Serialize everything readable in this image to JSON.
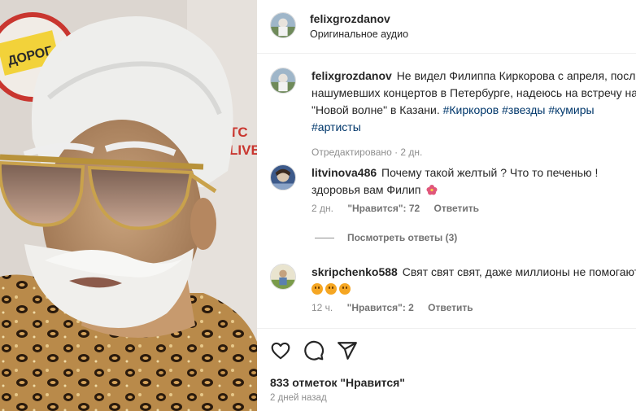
{
  "header": {
    "username": "felixgrozdanov",
    "audio": "Оригинальное аудио"
  },
  "caption": {
    "username": "felixgrozdanov",
    "text_line1": "Не видел Филиппа Киркорова с апреля, после",
    "text_line2": "нашумевших концертов в Петербурге, надеюсь на встречу на",
    "text_line3_a": "\"Новой волне\" в Казани.",
    "hashtags_line3": [
      "#Киркоров",
      "#звезды",
      "#кумиры"
    ],
    "hashtag_line4": "#артисты",
    "meta": "Отредактировано · 2 дн."
  },
  "comments": [
    {
      "username": "litvinova486",
      "text_line1": "Почему такой желтый ? Что то печенью !",
      "text_line2": "здоровья вам Филип",
      "time": "2 дн.",
      "likes": "\"Нравится\": 72",
      "reply": "Ответить",
      "view_replies": "Посмотреть ответы (3)"
    },
    {
      "username": "skripchenko588",
      "text_line1": "Свят свят свят, даже миллионы не помогают",
      "time": "12 ч.",
      "likes": "\"Нравится\": 2",
      "reply": "Ответить"
    }
  ],
  "footer": {
    "likes": "833 отметок \"Нравится\"",
    "date": "2 дней назад"
  },
  "media": {
    "background_signs": [
      "ДОРОГ",
      "TC",
      "LIVE"
    ]
  },
  "colors": {
    "hashtag": "#00376b",
    "muted": "#8e8e8e",
    "text": "#262626"
  }
}
